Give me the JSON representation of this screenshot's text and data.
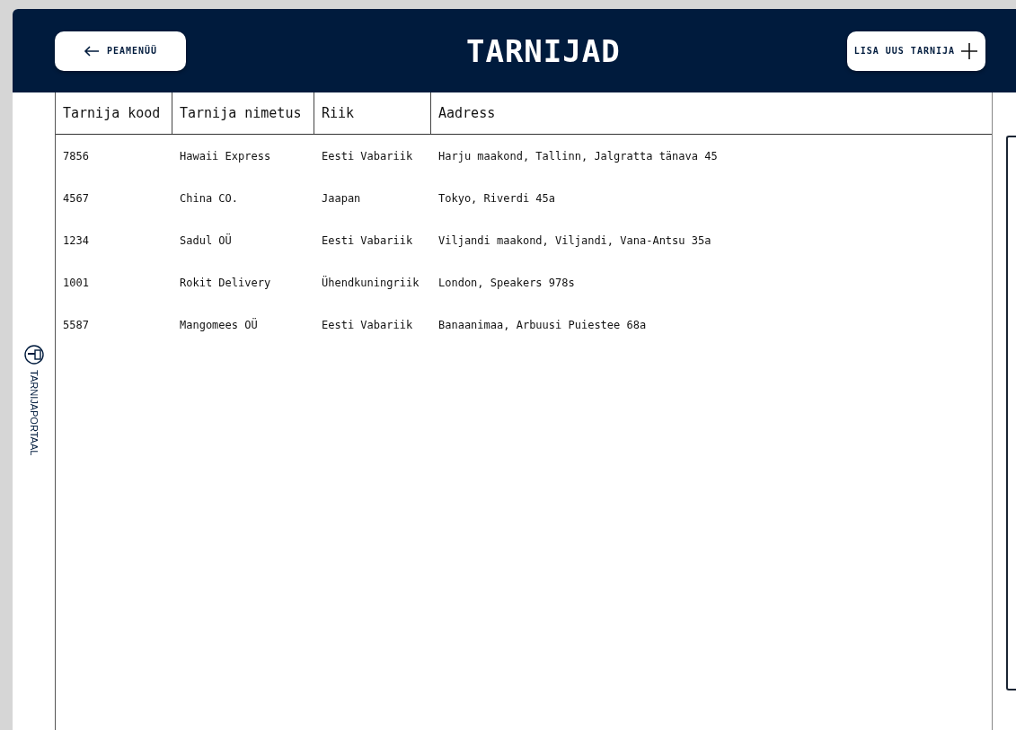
{
  "header": {
    "back_button": "PEAMENÜÜ",
    "title": "TARNIJAD",
    "add_button": "LISA UUS TARNIJA"
  },
  "sidebar": {
    "label": "TARNIJAPORTAAL"
  },
  "table": {
    "columns": [
      "Tarnija kood",
      "Tarnija nimetus",
      "Riik",
      "Aadress"
    ],
    "rows": [
      [
        "7856",
        "Hawaii Express",
        "Eesti Vabariik",
        "Harju maakond, Tallinn, Jalgratta tänava 45"
      ],
      [
        "4567",
        "China CO.",
        "Jaapan",
        "Tokyo, Riverdi 45a"
      ],
      [
        "1234",
        "Sadul OÜ",
        "Eesti Vabariik",
        "Viljandi maakond, Viljandi, Vana-Antsu 35a"
      ],
      [
        "1001",
        "Rokit Delivery",
        "Ühendkuningriik",
        "London, Speakers 978s"
      ],
      [
        "5587",
        "Mangomees OÜ",
        "Eesti Vabariik",
        "Banaanimaa, Arbuusi Puiestee 68a"
      ]
    ]
  }
}
